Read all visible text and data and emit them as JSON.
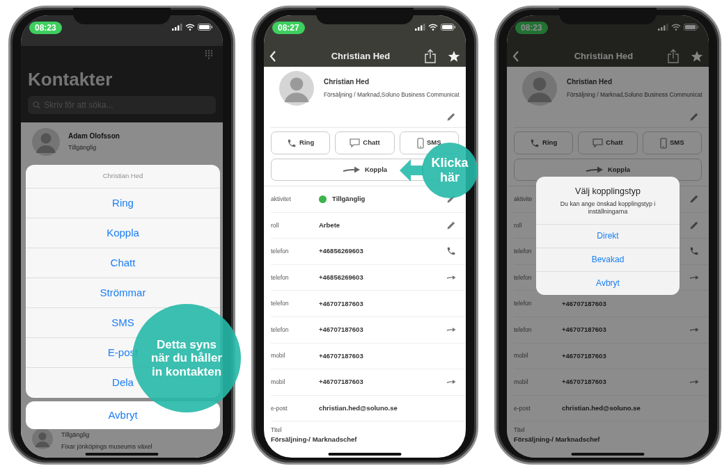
{
  "phones": [
    {
      "kind": "contacts",
      "time": "08:23",
      "title": "Kontakter",
      "search": {
        "placeholder": "Skriv för att söka..."
      },
      "contacts": [
        {
          "name": "Adam Olofsson",
          "status": "Tillgänglig"
        },
        {
          "status": "Tillgänglig",
          "note": "Fixar jönköpings museums växel"
        }
      ],
      "action_sheet": {
        "title": "Christian Hed",
        "items": [
          "Ring",
          "Koppla",
          "Chatt",
          "Strömmar",
          "SMS",
          "E-post",
          "Dela"
        ],
        "cancel": "Avbryt"
      },
      "callout": {
        "text": "Detta syns när du håller in kontakten"
      }
    },
    {
      "kind": "detail",
      "time": "08:27",
      "title": "Christian Hed",
      "profile": {
        "name": "Christian Hed",
        "department": "Försäljning / Marknad,Soluno Business Communicat"
      },
      "actions": [
        {
          "label": "Ring",
          "kind": "call"
        },
        {
          "label": "Chatt",
          "kind": "chat"
        },
        {
          "label": "SMS",
          "kind": "sms"
        }
      ],
      "connect": "Koppla",
      "fields": [
        {
          "label": "aktivitet",
          "value": "Tillgänglig",
          "color": "#3cb44b",
          "kind": "editable"
        },
        {
          "label": "roll",
          "value": "Arbete",
          "kind": "editable"
        },
        {
          "label": "telefon",
          "value": "+46856269603",
          "kind": "callable"
        },
        {
          "label": "telefon",
          "value": "+46856269603",
          "kind": "transferable"
        },
        {
          "label": "telefon",
          "value": "+46707187603",
          "kind": "plain"
        },
        {
          "label": "telefon",
          "value": "+46707187603",
          "kind": "transferable"
        },
        {
          "label": "mobil",
          "value": "+46707187603",
          "kind": "plain"
        },
        {
          "label": "mobil",
          "value": "+46707187603",
          "kind": "transferable"
        },
        {
          "label": "e-post",
          "value": "christian.hed@soluno.se"
        }
      ],
      "title_field": {
        "label": "Titel",
        "value": "Försäljning-/ Marknadschef"
      },
      "callout": {
        "text": "Klicka här"
      }
    },
    {
      "kind": "detail",
      "time": "08:23",
      "title": "Christian Hed",
      "profile": {
        "name": "Christian Hed",
        "department": "Försäljning / Marknad,Soluno Business Communicat"
      },
      "actions": [
        {
          "label": "Ring",
          "kind": "call"
        },
        {
          "label": "Chatt",
          "kind": "chat"
        },
        {
          "label": "SMS",
          "kind": "sms"
        }
      ],
      "connect": "Koppla",
      "fields": [
        {
          "label": "aktivite",
          "kind": "editable"
        },
        {
          "label": "roll",
          "kind": "editable"
        },
        {
          "label": "telefon",
          "kind": "callable"
        },
        {
          "label": "telefon",
          "kind": "transferable"
        },
        {
          "label": "telefon",
          "value": "+46707187603",
          "kind": "plain"
        },
        {
          "label": "telefon",
          "value": "+46707187603",
          "kind": "transferable"
        },
        {
          "label": "mobil",
          "value": "+46707187603",
          "kind": "plain"
        },
        {
          "label": "mobil",
          "value": "+46707187603",
          "kind": "transferable"
        },
        {
          "label": "e-post",
          "value": "christian.hed@soluno.se"
        }
      ],
      "title_field": {
        "label": "Titel",
        "value": "Försäljning-/ Marknadschef"
      },
      "dialog": {
        "title": "Välj kopplingstyp",
        "message": "Du kan ange önskad kopplingstyp i inställningarna",
        "options": [
          "Direkt",
          "Bevakad",
          "Avbryt"
        ]
      }
    }
  ]
}
